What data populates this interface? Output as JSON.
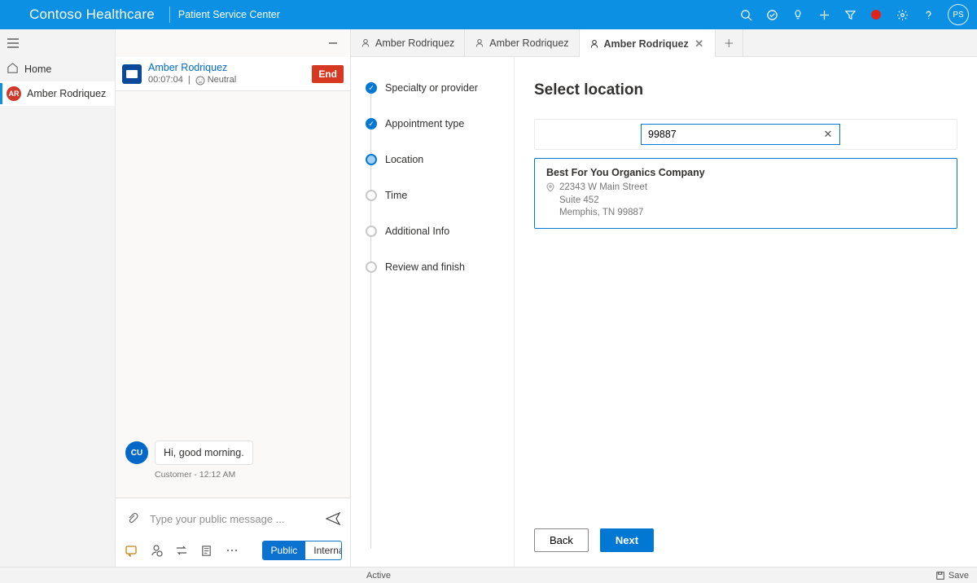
{
  "header": {
    "brand": "Contoso Healthcare",
    "subtitle": "Patient Service Center",
    "avatar_initials": "PS"
  },
  "nav": {
    "home_label": "Home",
    "patient_label": "Amber Rodriquez",
    "patient_initials": "AR"
  },
  "chat": {
    "patient_name": "Amber Rodriquez",
    "timer": "00:07:04",
    "sentiment": "Neutral",
    "end_button": "End",
    "customer_badge": "CU",
    "message_text": "Hi, good morning.",
    "message_meta": "Customer - 12:12 AM",
    "input_placeholder": "Type your public message ...",
    "toggle_public": "Public",
    "toggle_internal": "Internal"
  },
  "tabs": {
    "tab1": "Amber Rodriquez",
    "tab2": "Amber Rodriquez",
    "tab3": "Amber Rodriquez"
  },
  "stepper": {
    "s1": "Specialty or provider",
    "s2": "Appointment type",
    "s3": "Location",
    "s4": "Time",
    "s5": "Additional Info",
    "s6": "Review and finish"
  },
  "location": {
    "heading": "Select location",
    "search_value": "99887",
    "result": {
      "title": "Best For You Organics Company",
      "addr_line1": "22343 W Main Street",
      "addr_line2": "Suite 452",
      "addr_line3": "Memphis, TN 99887"
    },
    "back": "Back",
    "next": "Next"
  },
  "statusbar": {
    "status": "Active",
    "save": "Save"
  }
}
